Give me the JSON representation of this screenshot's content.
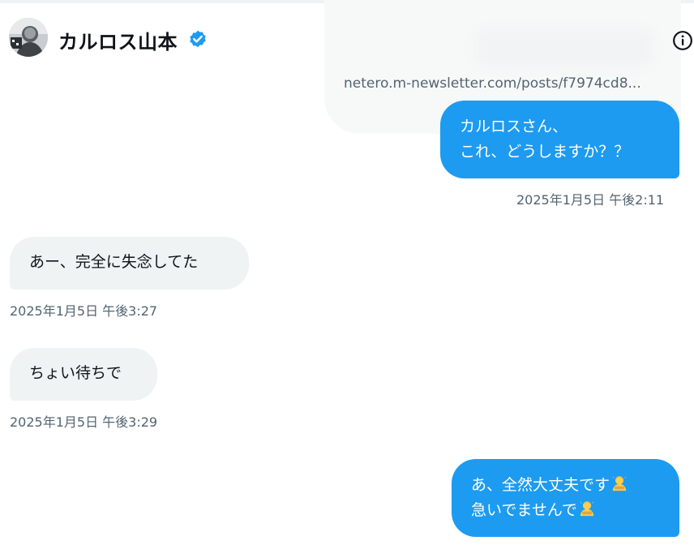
{
  "header": {
    "name": "カルロス山本",
    "verified_icon": "verified-badge-icon",
    "info_icon": "info-icon"
  },
  "link_preview": {
    "url": "netero.m-newsletter.com/posts/f7974cd8..."
  },
  "messages": [
    {
      "direction": "outgoing",
      "lines": [
        "カルロスさん、",
        "これ、どうしますか？？"
      ],
      "timestamp": "2025年1月5日 午後2:11"
    },
    {
      "direction": "incoming",
      "lines": [
        "あー、完全に失念してた"
      ],
      "timestamp": "2025年1月5日 午後3:27"
    },
    {
      "direction": "incoming",
      "lines": [
        "ちょい待ちで"
      ],
      "timestamp": "2025年1月5日 午後3:29"
    },
    {
      "direction": "outgoing",
      "lines": [
        "あ、全然大丈夫です",
        "急いでませんで"
      ],
      "emoji": "person-bowing-emoji"
    }
  ],
  "colors": {
    "outgoing_bubble": "#1d9bf0",
    "incoming_bubble": "#eff3f4",
    "timestamp": "#536471",
    "verified": "#1d9bf0"
  }
}
